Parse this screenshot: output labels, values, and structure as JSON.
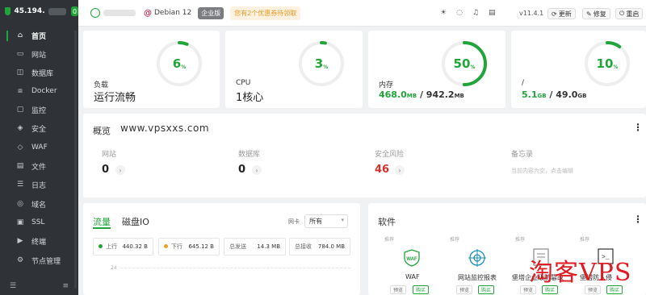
{
  "sidebar": {
    "ip": "45.194.",
    "badge": "0",
    "items": [
      {
        "label": "首页",
        "icon": "home-icon",
        "glyph": "⌂"
      },
      {
        "label": "网站",
        "icon": "website-icon",
        "glyph": "▭"
      },
      {
        "label": "数据库",
        "icon": "database-icon",
        "glyph": "◫"
      },
      {
        "label": "Docker",
        "icon": "docker-icon",
        "glyph": "⧈"
      },
      {
        "label": "监控",
        "icon": "monitor-icon",
        "glyph": "▢"
      },
      {
        "label": "安全",
        "icon": "shield-icon",
        "glyph": "◈"
      },
      {
        "label": "WAF",
        "icon": "waf-icon",
        "glyph": "◇"
      },
      {
        "label": "文件",
        "icon": "folder-icon",
        "glyph": "▤"
      },
      {
        "label": "日志",
        "icon": "log-icon",
        "glyph": "☰"
      },
      {
        "label": "域名",
        "icon": "globe-icon",
        "glyph": "◎"
      },
      {
        "label": "SSL",
        "icon": "ssl-icon",
        "glyph": "▣"
      },
      {
        "label": "终端",
        "icon": "terminal-icon",
        "glyph": "▶"
      },
      {
        "label": "节点管理",
        "icon": "node-icon",
        "glyph": "⚙"
      }
    ]
  },
  "topbar": {
    "os": "Debian 12",
    "edition": "企业版",
    "promo": "您有2个优惠券待领取",
    "version": "v11.4.1",
    "update": "更新",
    "repair": "修复",
    "restart": "重启"
  },
  "stats": [
    {
      "label": "负载",
      "value": "运行流畅",
      "percent": 6
    },
    {
      "label": "CPU",
      "value": "1核心",
      "percent": 3
    },
    {
      "label": "内存",
      "used": "468.0",
      "used_unit": "MB",
      "total": "942.2",
      "total_unit": "MB",
      "percent": 50
    },
    {
      "label": "/",
      "used": "5.1",
      "used_unit": "GB",
      "total": "49.0",
      "total_unit": "GB",
      "percent": 10
    }
  ],
  "overview": {
    "title": "概览",
    "site_text": "www.vpsxxs.com",
    "items": [
      {
        "label": "网站",
        "value": "0"
      },
      {
        "label": "数据库",
        "value": "0"
      },
      {
        "label": "安全风险",
        "value": "46"
      },
      {
        "label": "备忘录",
        "hint": "当前内容为空，点击编辑"
      }
    ]
  },
  "traffic": {
    "tab_flow": "流量",
    "tab_disk": "磁盘IO",
    "nic_label": "网卡",
    "nic_value": "所有",
    "up_label": "上行",
    "up_value": "440.32 B",
    "down_label": "下行",
    "down_value": "645.12 B",
    "sent_label": "总发送",
    "sent_value": "14.3 MB",
    "recv_label": "总接收",
    "recv_value": "784.0 MB",
    "axis_tick": "24"
  },
  "software": {
    "title": "软件",
    "tag": "推荐",
    "items": [
      {
        "name": "WAF",
        "preview": "预览",
        "buy": "购买"
      },
      {
        "name": "网站监控报表",
        "preview": "预览",
        "buy": "购买"
      },
      {
        "name": "堡塔企业级防篡改",
        "preview": "预览",
        "buy": "购买"
      },
      {
        "name": "堡塔防入侵",
        "preview": "预览",
        "buy": "购买"
      }
    ]
  },
  "watermark": "淘客VPS",
  "colors": {
    "accent": "#20a53a",
    "danger": "#d9302d",
    "sidebar": "#2f3337"
  }
}
